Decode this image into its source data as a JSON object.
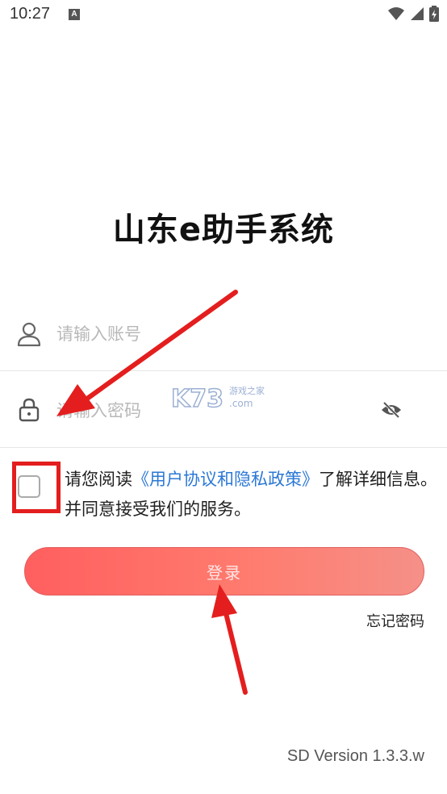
{
  "status_bar": {
    "time": "10:27",
    "notification_icon": "a-badge-icon",
    "icons": [
      "wifi-icon",
      "signal-icon",
      "battery-charging-icon"
    ]
  },
  "app": {
    "title": "山东e助手系统"
  },
  "account_field": {
    "placeholder": "请输入账号",
    "value": "",
    "icon": "user-icon"
  },
  "password_field": {
    "placeholder": "请输入密码",
    "value": "",
    "icon": "lock-icon",
    "toggle_icon": "eye-off-icon"
  },
  "agreement": {
    "checked": false,
    "prefix": "请您阅读",
    "link_text": "《用户协议和隐私政策》",
    "suffix": "了解详细信息。并同意接受我们的服务。"
  },
  "login_button": {
    "label": "登录"
  },
  "forgot_password": {
    "label": "忘记密码"
  },
  "version": {
    "text": "SD Version 1.3.3.w"
  },
  "watermark": {
    "brand": "K73",
    "site_cn": "游戏之家",
    "domain": ".com"
  },
  "colors": {
    "accent_red": "#ff6b6b",
    "link_blue": "#2b78d6",
    "annotation_red": "#e41e1e"
  }
}
